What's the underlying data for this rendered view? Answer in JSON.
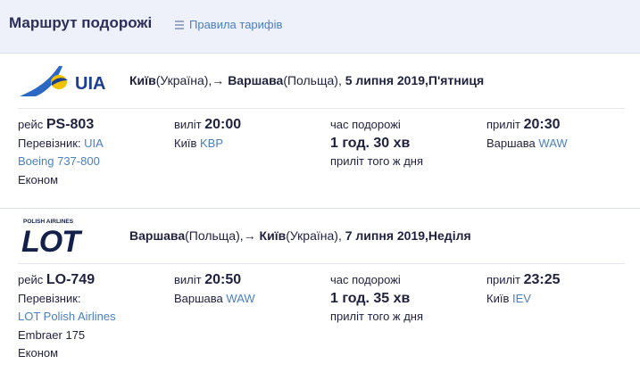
{
  "header": {
    "title": "Маршрут подорожі",
    "rules_label": "Правила тарифів",
    "rules_icon": "list-icon"
  },
  "segments": [
    {
      "airline_logo": "UIA",
      "route": {
        "from_city": "Київ",
        "from_country": "(Україна),",
        "arrow": "→",
        "to_city": "Варшава",
        "to_country": "(Польща),",
        "date": "5 липня 2019,П'ятниця"
      },
      "flight_label": "рейс",
      "flight_number": "PS-803",
      "carrier_label": "Перевізник:",
      "carrier": "UIA",
      "aircraft": "Boeing 737-800",
      "cabin": "Економ",
      "departure_label": "виліт",
      "departure_time": "20:00",
      "departure_city": "Київ",
      "departure_code": "KBP",
      "duration_label": "час подорожі",
      "duration": "1 год. 30 хв",
      "arrival_note": "приліт того ж дня",
      "arrival_label": "приліт",
      "arrival_time": "20:30",
      "arrival_city": "Варшава",
      "arrival_code": "WAW"
    },
    {
      "airline_logo": "LOT",
      "airline_logo_caption": "POLISH AIRLINES",
      "route": {
        "from_city": "Варшава",
        "from_country": "(Польща),",
        "arrow": "→",
        "to_city": "Київ",
        "to_country": "(Україна),",
        "date": "7 липня 2019,Неділя"
      },
      "flight_label": "рейс",
      "flight_number": "LO-749",
      "carrier_label": "Перевізник:",
      "carrier": "LOT Polish Airlines",
      "aircraft": "Embraer 175",
      "cabin": "Економ",
      "departure_label": "виліт",
      "departure_time": "20:50",
      "departure_city": "Варшава",
      "departure_code": "WAW",
      "duration_label": "час подорожі",
      "duration": "1 год. 35 хв",
      "arrival_note": "приліт того ж дня",
      "arrival_label": "приліт",
      "arrival_time": "23:25",
      "arrival_city": "Київ",
      "arrival_code": "IEV"
    }
  ],
  "colors": {
    "header_bg": "#eef1fa",
    "link": "#4a7fc1",
    "text": "#1f2140",
    "uia_blue": "#1c3f94",
    "uia_yellow": "#f2c200",
    "lot_navy": "#12204a"
  }
}
